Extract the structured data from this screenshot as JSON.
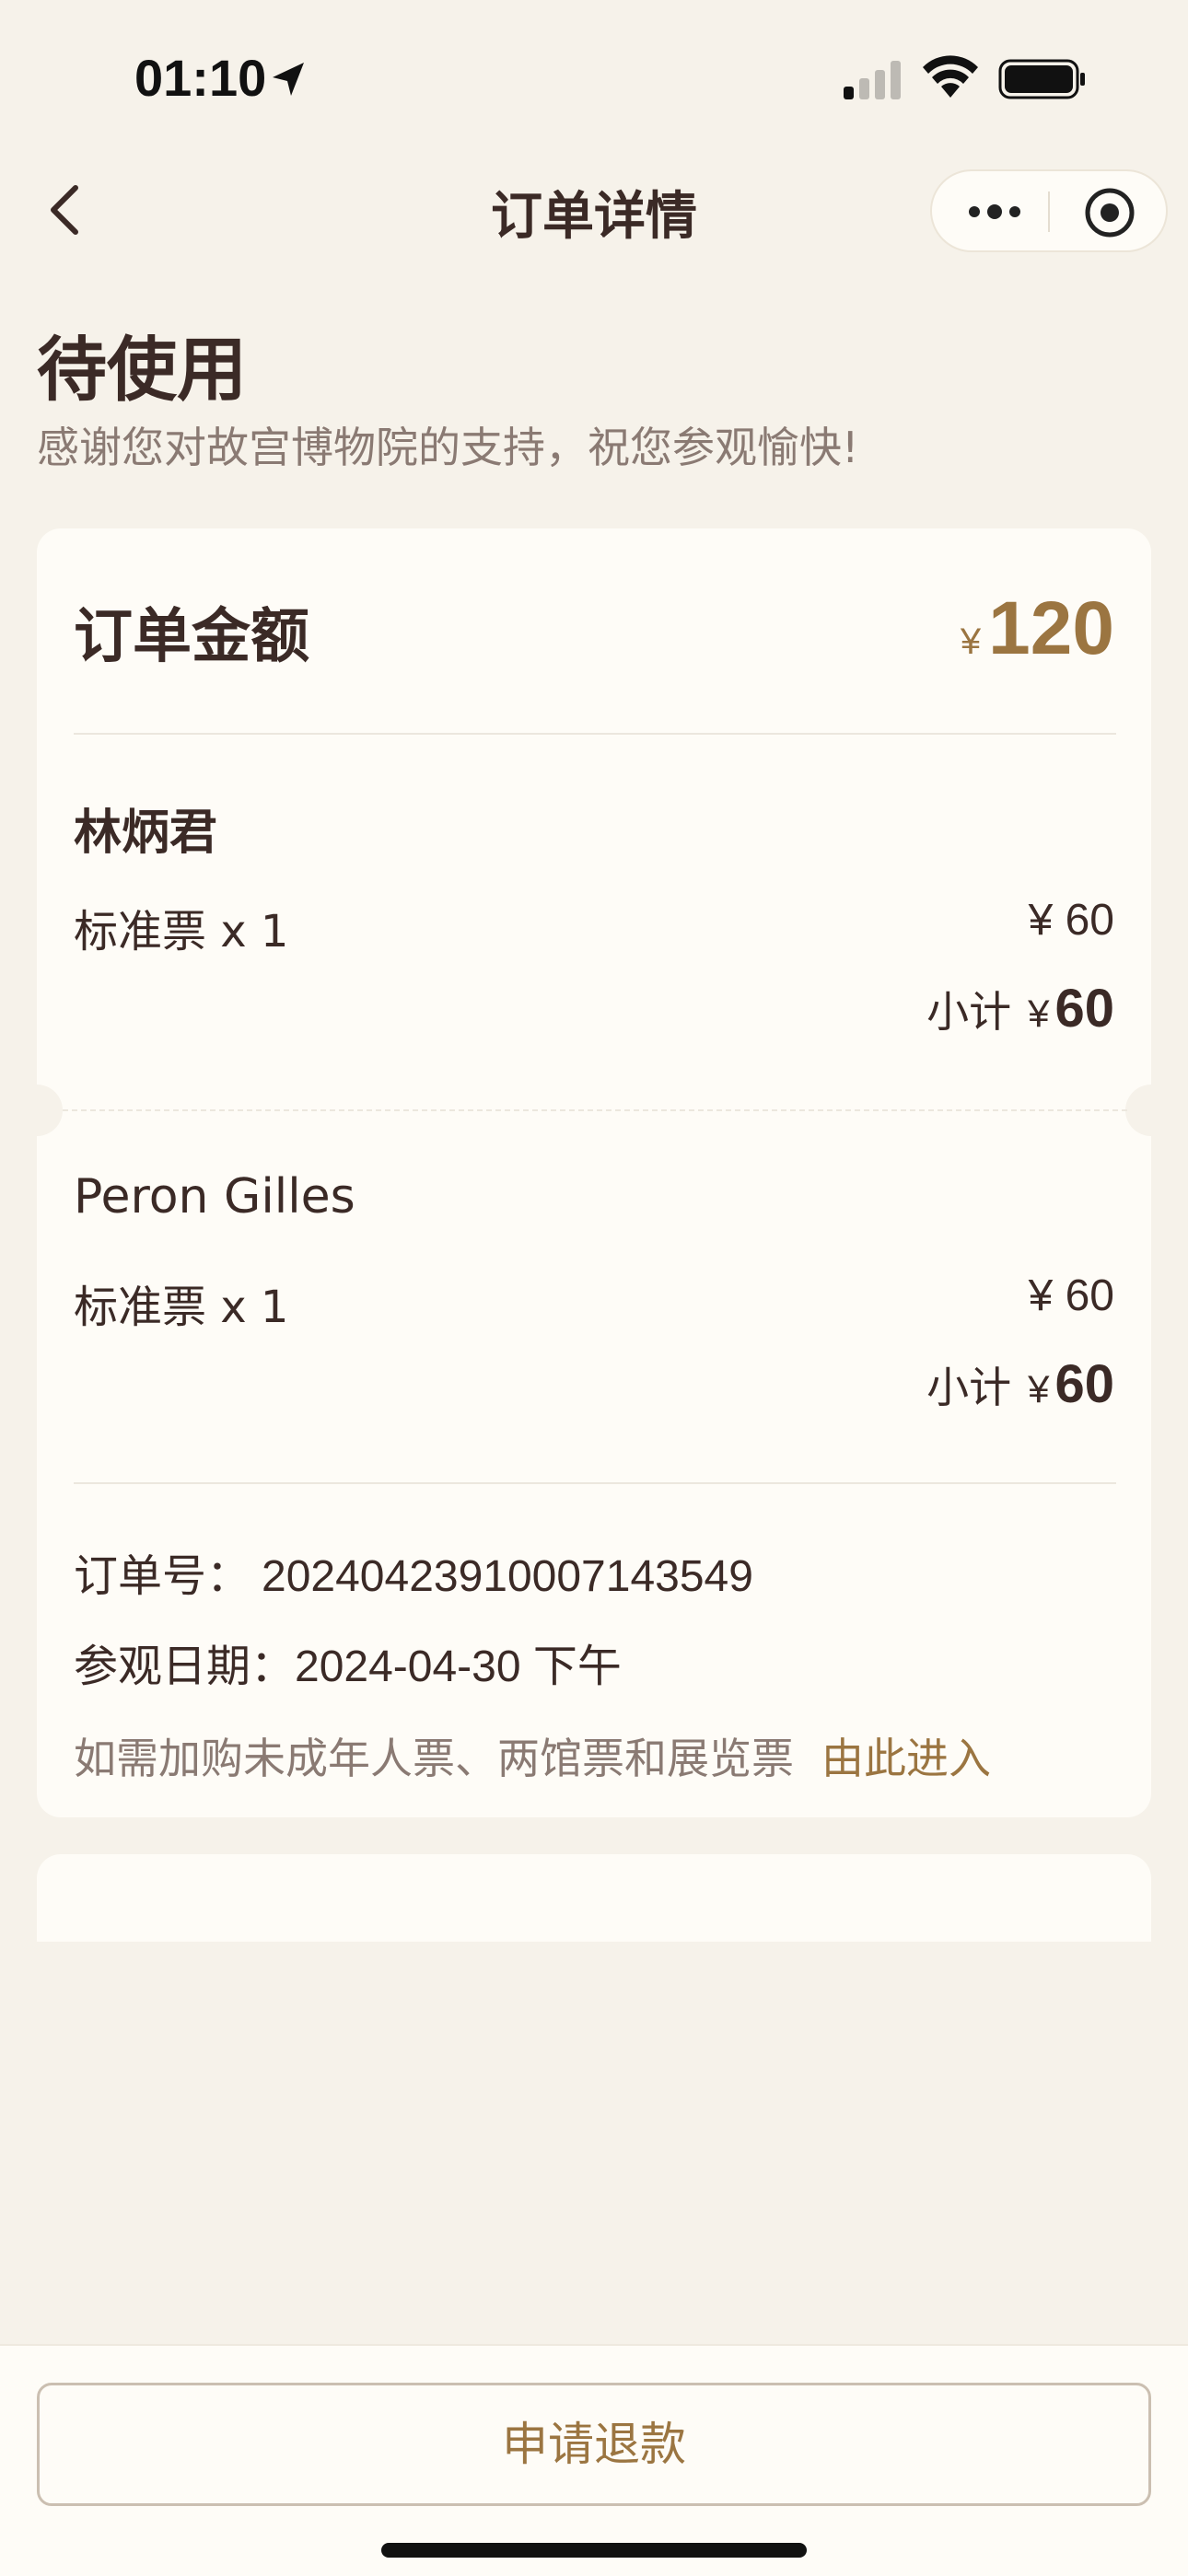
{
  "status_bar": {
    "time": "01:10",
    "icons": [
      "location-arrow-icon",
      "cellular-signal-icon",
      "wifi-icon",
      "battery-icon"
    ]
  },
  "nav": {
    "title": "订单详情",
    "back_icon": "chevron-left-icon",
    "more_icon": "more-dots-icon",
    "close_icon": "target-circle-icon"
  },
  "header": {
    "status": "待使用",
    "message": "感谢您对故宫博物院的支持，祝您参观愉快!"
  },
  "order": {
    "amount_label": "订单金额",
    "currency": "¥",
    "amount": "120",
    "visitors": [
      {
        "name": "林炳君",
        "ticket_type": "标准票 x 1",
        "price": "¥ 60",
        "subtotal_label": "小计",
        "subtotal_currency": "¥",
        "subtotal": "60"
      },
      {
        "name": "Peron Gilles",
        "ticket_type": "标准票 x 1",
        "price": "¥ 60",
        "subtotal_label": "小计",
        "subtotal_currency": "¥",
        "subtotal": "60"
      }
    ],
    "order_no_label": "订单号：",
    "order_no": "20240423910007143549",
    "visit_date_label": "参观日期：",
    "visit_date": "2024-04-30 下午",
    "notice": "如需加购未成年人票、两馆票和展览票",
    "notice_link": "由此进入"
  },
  "footer": {
    "refund_label": "申请退款"
  },
  "colors": {
    "background": "#f6f2ea",
    "card": "#fefcf7",
    "text_primary": "#3b2a26",
    "text_secondary": "#8a7a73",
    "accent_gold": "#9b7541"
  }
}
